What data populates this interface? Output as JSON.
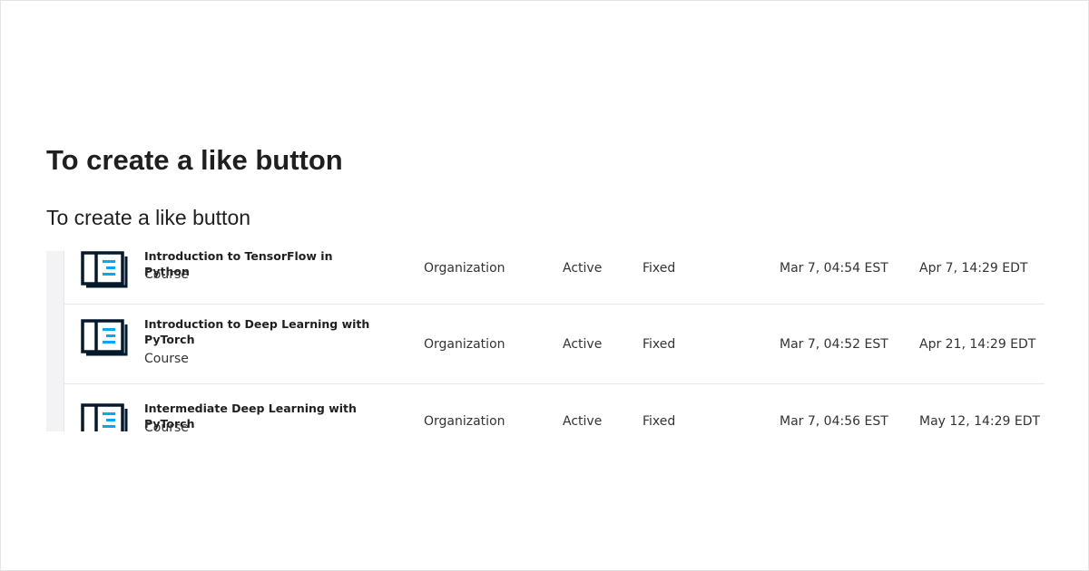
{
  "page": {
    "heading": "To create a like button",
    "subheading": "To create a like button"
  },
  "assignments": {
    "rows": [
      {
        "title": "Introduction to TensorFlow in Python",
        "content_type": "Course",
        "scope": "Organization",
        "status": "Active",
        "deadline_type": "Fixed",
        "assigned": "Mar 7, 04:54 EST",
        "due": "Apr 7, 14:29 EDT",
        "icon": "course-icon"
      },
      {
        "title": "Introduction to Deep Learning with PyTorch",
        "content_type": "Course",
        "scope": "Organization",
        "status": "Active",
        "deadline_type": "Fixed",
        "assigned": "Mar 7, 04:52 EST",
        "due": "Apr 21, 14:29 EDT",
        "icon": "course-icon"
      },
      {
        "title": "Intermediate Deep Learning with PyTorch",
        "content_type": "Course",
        "scope": "Organization",
        "status": "Active",
        "deadline_type": "Fixed",
        "assigned": "Mar 7, 04:56 EST",
        "due": "May 12, 14:29 EDT",
        "icon": "course-icon"
      }
    ]
  },
  "colors": {
    "text": "#1f1f1f",
    "icon_dark": "#05192d",
    "icon_accent": "#03a9f4",
    "divider": "#e8e8ea"
  }
}
